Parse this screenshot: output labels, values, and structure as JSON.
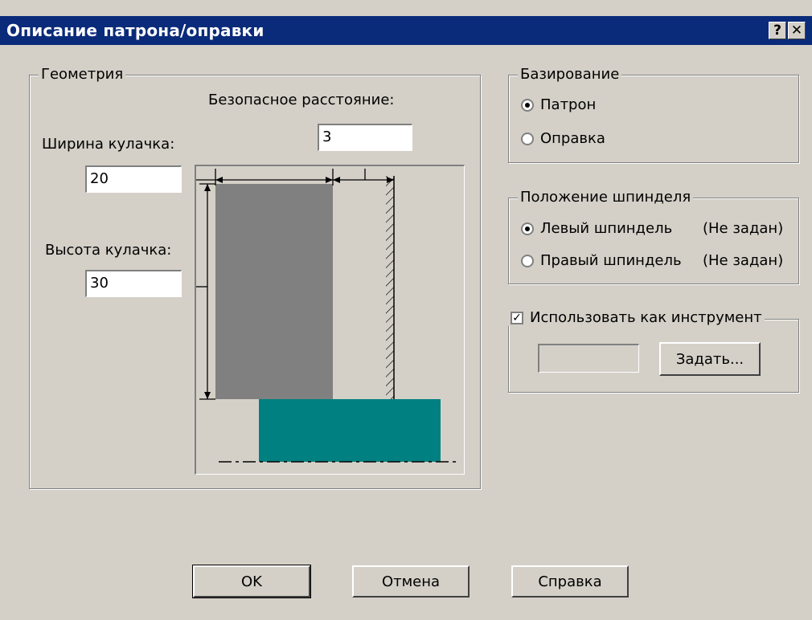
{
  "window": {
    "title": "Описание патрона/оправки",
    "help_button": "?",
    "close_button": "✕"
  },
  "geometry": {
    "legend": "Геометрия",
    "safe_distance_label": "Безопасное расстояние:",
    "safe_distance_value": "3",
    "jaw_width_label": "Ширина кулачка:",
    "jaw_width_value": "20",
    "jaw_height_label": "Высота кулачка:",
    "jaw_height_value": "30"
  },
  "basing": {
    "legend": "Базирование",
    "options": [
      {
        "label": "Патрон",
        "selected": true
      },
      {
        "label": "Оправка",
        "selected": false
      }
    ]
  },
  "spindle": {
    "legend": "Положение шпинделя",
    "options": [
      {
        "label": "Левый шпиндель",
        "status": "(Не задан)",
        "selected": true
      },
      {
        "label": "Правый шпиндель",
        "status": "(Не задан)",
        "selected": false
      }
    ]
  },
  "tool": {
    "checkbox_label": "Использовать как инструмент",
    "checked": true,
    "field_value": "",
    "set_button": "Задать..."
  },
  "buttons": {
    "ok": "OK",
    "cancel": "Отмена",
    "help": "Справка"
  },
  "colors": {
    "titlebar": "#0a2a7a",
    "face": "#d4d0c8",
    "jaw": "#808080",
    "part": "#008080"
  }
}
